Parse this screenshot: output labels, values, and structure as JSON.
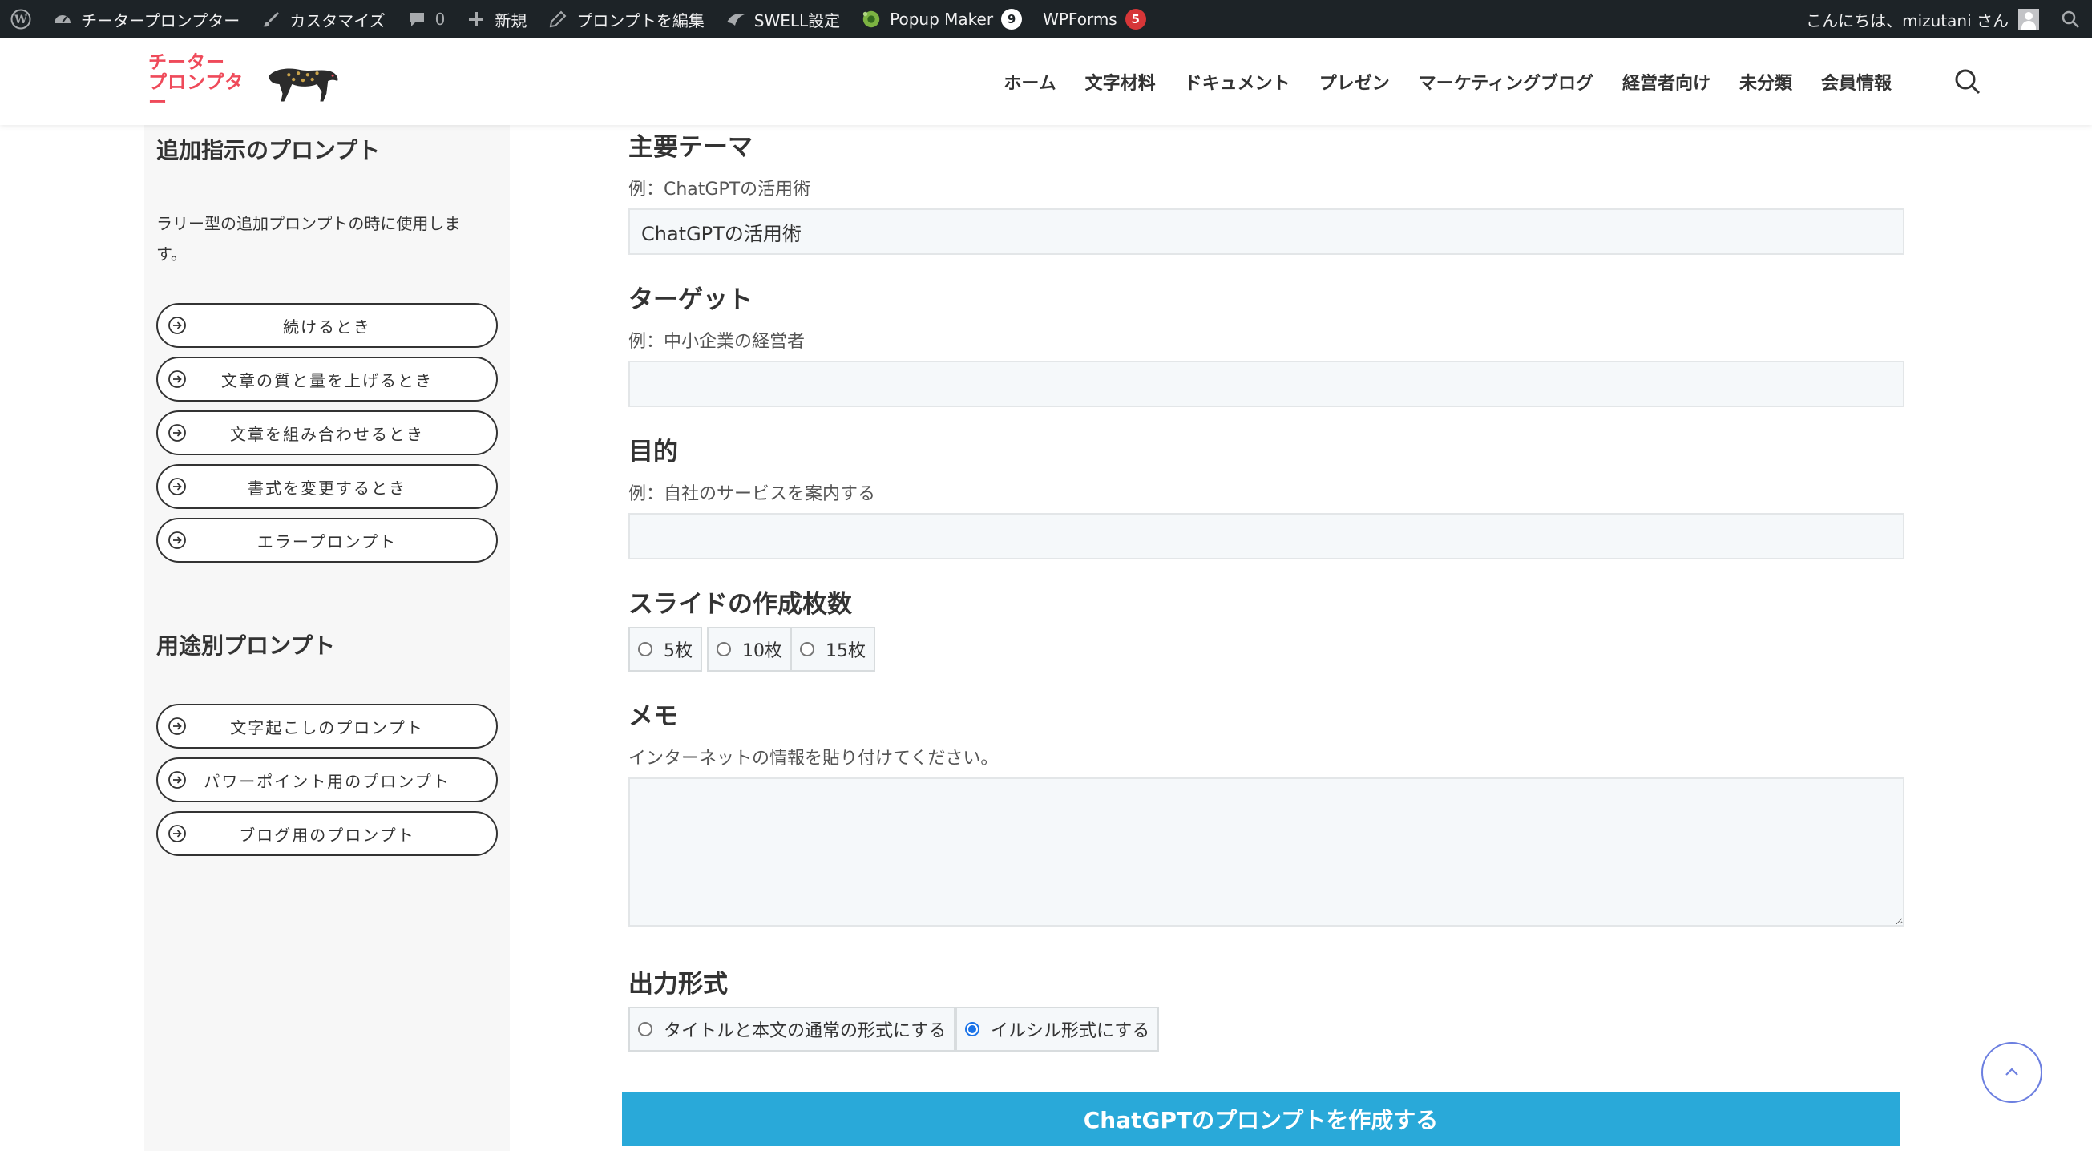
{
  "adminbar": {
    "site_name": "チータープロンプター",
    "customize": "カスタマイズ",
    "comments_count": "0",
    "new": "新規",
    "edit": "プロンプトを編集",
    "swell": "SWELL設定",
    "popup_maker": "Popup Maker",
    "popup_count": "9",
    "wpforms": "WPForms",
    "wpforms_count": "5",
    "greeting": "こんにちは、mizutani さん"
  },
  "header": {
    "logo_line1": "チーター",
    "logo_line2": "プロンプター",
    "nav": [
      "ホーム",
      "文字材料",
      "ドキュメント",
      "プレゼン",
      "マーケティングブログ",
      "経営者向け",
      "未分類",
      "会員情報"
    ]
  },
  "sidebar": {
    "section1_title": "追加指示のプロンプト",
    "section1_desc": "ラリー型の追加プロンプトの時に使用します。",
    "section1_buttons": [
      "続けるとき",
      "文章の質と量を上げるとき",
      "文章を組み合わせるとき",
      "書式を変更するとき",
      "エラープロンプト"
    ],
    "section2_title": "用途別プロンプト",
    "section2_buttons": [
      "文字起こしのプロンプト",
      "パワーポイント用のプロンプト",
      "ブログ用のプロンプト"
    ]
  },
  "form": {
    "theme_label": "主要テーマ",
    "theme_example": "例：ChatGPTの活用術",
    "theme_value": "ChatGPTの活用術",
    "target_label": "ターゲット",
    "target_example": "例：中小企業の経営者",
    "target_value": "",
    "purpose_label": "目的",
    "purpose_example": "例：自社のサービスを案内する",
    "purpose_value": "",
    "slides_label": "スライドの作成枚数",
    "slides_options": [
      "5枚",
      "10枚",
      "15枚"
    ],
    "memo_label": "メモ",
    "memo_example": "インターネットの情報を貼り付けてください。",
    "memo_value": "",
    "output_label": "出力形式",
    "output_options": [
      "タイトルと本文の通常の形式にする",
      "イルシル形式にする"
    ],
    "output_selected": "イルシル形式にする",
    "submit_label": "ChatGPTのプロンプトを作成する"
  },
  "colors": {
    "adminbar_bg": "#1d2327",
    "logo_red": "#ef4a5a",
    "submit_blue": "#29a9d9",
    "sidebar_bg": "#f7f7f7"
  }
}
